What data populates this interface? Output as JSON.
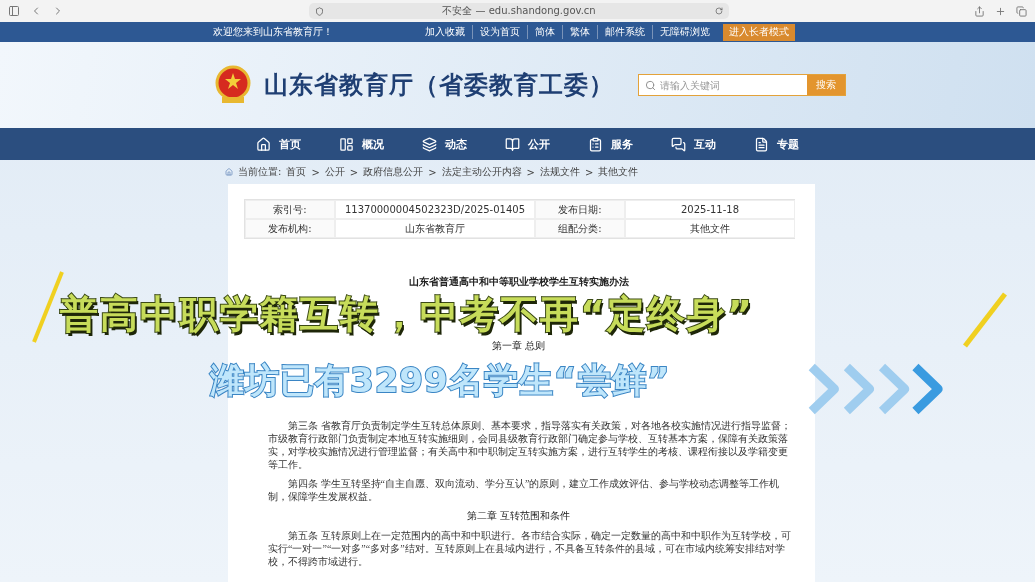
{
  "browser": {
    "address": "不安全 — edu.shandong.gov.cn"
  },
  "top_bar": {
    "welcome": "欢迎您来到山东省教育厅！",
    "links": [
      "加入收藏",
      "设为首页",
      "简体",
      "繁体",
      "邮件系统",
      "无障碍浏览"
    ],
    "elder_button": "进入长者模式"
  },
  "header": {
    "site_title": "山东省教育厅（省委教育工委）",
    "search": {
      "placeholder": "请输入关键词",
      "button": "搜索"
    }
  },
  "nav": [
    {
      "label": "首页",
      "kind": "home"
    },
    {
      "label": "概况",
      "kind": "overview"
    },
    {
      "label": "动态",
      "kind": "news"
    },
    {
      "label": "公开",
      "kind": "open"
    },
    {
      "label": "服务",
      "kind": "service"
    },
    {
      "label": "互动",
      "kind": "chat"
    },
    {
      "label": "专题",
      "kind": "topic"
    }
  ],
  "breadcrumb": {
    "label": "当前位置:",
    "separator": ">",
    "items": [
      "首页",
      "公开",
      "政府信息公开",
      "法定主动公开内容",
      "法规文件",
      "其他文件"
    ]
  },
  "info_table": [
    [
      "索引号:",
      "11370000004502323D/2025-01405",
      "发布日期:",
      "2025-11-18"
    ],
    [
      "发布机构:",
      "山东省教育厅",
      "组配分类:",
      "其他文件"
    ]
  ],
  "article": {
    "title": "山东省普通高中和中等职业学校学生互转实施办法",
    "blocks": [
      {
        "kind": "heading",
        "text": "第一章 总则"
      },
      {
        "kind": "para",
        "text": "第三条 省教育厅负责制定学生互转总体原则、基本要求，指导落实有关政策，对各地各校实施情况进行指导监督；市级教育行政部门负责制定本地互转实施细则，会同县级教育行政部门确定参与学校、互转基本方案，保障有关政策落实，对学校实施情况进行管理监督；有关高中和中职制定互转实施方案，进行互转学生的考核、课程衔接以及学籍变更等工作。"
      },
      {
        "kind": "para",
        "text": "第四条 学生互转坚持“自主自愿、双向流动、学分互认”的原则，建立工作成效评估、参与学校动态调整等工作机制，保障学生发展权益。"
      },
      {
        "kind": "heading",
        "text": "第二章 互转范围和条件"
      },
      {
        "kind": "para",
        "text": "第五条 互转原则上在一定范围内的高中和中职进行。各市结合实际，确定一定数量的高中和中职作为互转学校，可实行“一对一”“一对多”“多对多”结对。互转原则上在县域内进行，不具备互转条件的县域，可在市域内统筹安排结对学校，不得跨市域进行。"
      }
    ]
  },
  "captions": [
    {
      "text": "普高中职学籍互转，中考不再“定终身”",
      "kind": "headline"
    },
    {
      "text": "潍坊已有3299名学生“尝鲜”",
      "kind": "sub"
    }
  ]
}
